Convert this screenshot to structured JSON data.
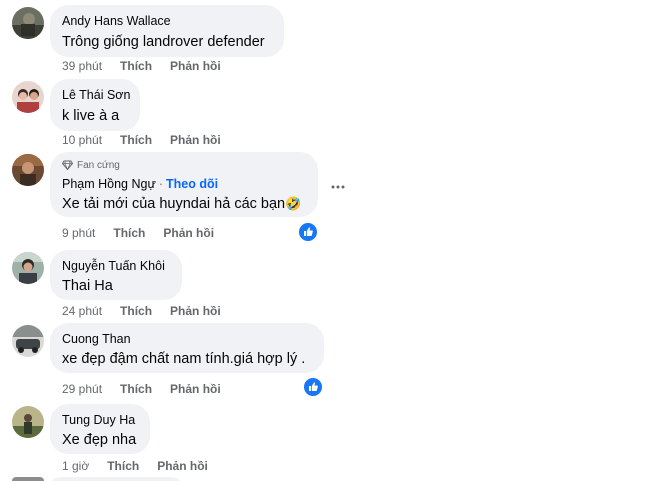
{
  "comments": [
    {
      "author": "Andy Hans Wallace",
      "text": "Trông giống landrover defender",
      "time": "39 phút",
      "like": "Thích",
      "reply": "Phản hồi"
    },
    {
      "author": "Lê Thái Sơn",
      "text": "k live à a",
      "time": "10 phút",
      "like": "Thích",
      "reply": "Phản hồi"
    },
    {
      "badge": "Fan cứng",
      "author": "Phạm Hồng Ngự",
      "follow": "Theo dõi",
      "text": "Xe tải mới của huyndai hả các bạn",
      "emoji": "🤣",
      "time": "9 phút",
      "like": "Thích",
      "reply": "Phản hồi"
    },
    {
      "author": "Nguyễn Tuấn Khôi",
      "text": "Thai Ha",
      "time": "24 phút",
      "like": "Thích",
      "reply": "Phản hồi"
    },
    {
      "author": "Cuong Than",
      "text": "xe đẹp đậm chất nam tính.giá hợp lý .",
      "time": "29 phút",
      "like": "Thích",
      "reply": "Phản hồi"
    },
    {
      "author": "Tung Duy Ha",
      "text": "Xe đẹp nha",
      "time": "1 giờ",
      "like": "Thích",
      "reply": "Phản hồi"
    }
  ],
  "colors": {
    "bubble": "#f0f2f5",
    "meta": "#65676b",
    "link": "#0866ff",
    "like": "#1877f2"
  },
  "icons": [
    "diamond-icon",
    "like-reaction-icon",
    "more-options-icon"
  ]
}
